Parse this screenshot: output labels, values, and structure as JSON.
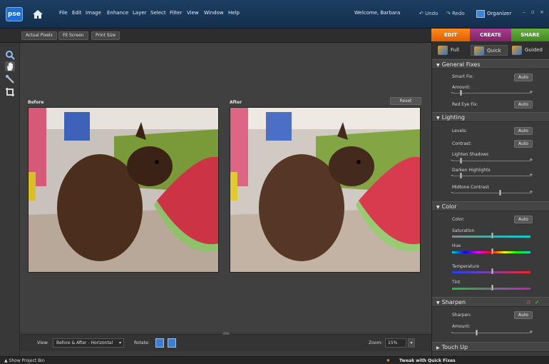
{
  "app": {
    "logo": "pse",
    "welcome": "Welcome, Barbara"
  },
  "menu": [
    "File",
    "Edit",
    "Image",
    "Enhance",
    "Layer",
    "Select",
    "Filter",
    "View",
    "Window",
    "Help"
  ],
  "toolbar": {
    "undo": "Undo",
    "redo": "Redo",
    "organizer": "Organizer",
    "minimize": "–",
    "restore": "▫",
    "close": "×"
  },
  "options": {
    "actual_pixels": "Actual Pixels",
    "fit_screen": "Fit Screen",
    "print_size": "Print Size"
  },
  "tabs": {
    "edit": "EDIT",
    "create": "CREATE",
    "share": "SHARE"
  },
  "modes": {
    "full": "Full",
    "quick": "Quick",
    "guided": "Guided"
  },
  "canvas": {
    "before_label": "Before",
    "after_label": "After",
    "reset_label": "Reset"
  },
  "viewbar": {
    "view_label": "View:",
    "view_value": "Before & After - Horizontal",
    "rotate_label": "Rotate:",
    "zoom_label": "Zoom:",
    "zoom_value": "15%"
  },
  "status": {
    "project_bin": "Show Project Bin",
    "hint": "Tweak with Quick Fixes"
  },
  "panel": {
    "general_fixes": {
      "title": "General Fixes",
      "smart_fix": "Smart Fix:",
      "amount": "Amount:",
      "red_eye_fix": "Red Eye Fix:",
      "auto": "Auto",
      "smart_fix_amount": 0.1
    },
    "lighting": {
      "title": "Lighting",
      "levels": "Levels:",
      "contrast": "Contrast:",
      "lighten_shadows": "Lighten Shadows",
      "darken_highlights": "Darken Highlights",
      "midtone_contrast": "Midtone Contrast",
      "auto": "Auto",
      "lighten_shadows_value": 0.1,
      "darken_highlights_value": 0.1,
      "midtone_contrast_value": 0.6
    },
    "color": {
      "title": "Color",
      "color": "Color:",
      "auto": "Auto",
      "saturation": "Saturation",
      "hue": "Hue",
      "temperature": "Temperature",
      "tint": "Tint",
      "saturation_value": 0.5,
      "hue_value": 0.5,
      "temperature_value": 0.5,
      "tint_value": 0.5
    },
    "sharpen": {
      "title": "Sharpen",
      "sharpen": "Sharpen:",
      "amount": "Amount:",
      "auto": "Auto",
      "amount_value": 0.3
    },
    "touch_up": {
      "title": "Touch Up"
    },
    "plus": "+",
    "minus": "–"
  },
  "colors": {
    "edit_tab": "#f07211",
    "create_tab": "#94317c",
    "share_tab": "#55a030",
    "titlebar": "#1a3a5c"
  }
}
